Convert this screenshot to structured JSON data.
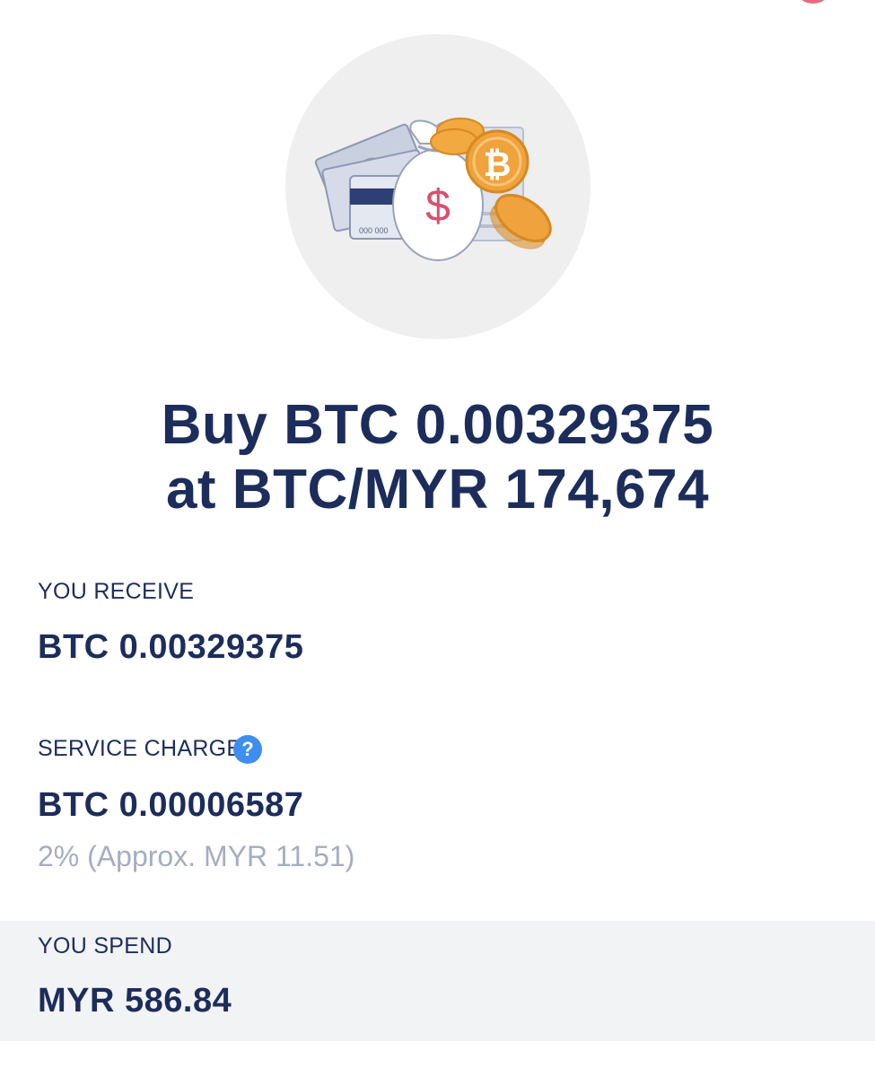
{
  "headline": {
    "line1": "Buy BTC 0.00329375",
    "line2": "at BTC/MYR 174,674"
  },
  "receive": {
    "label": "YOU RECEIVE",
    "value": "BTC 0.00329375"
  },
  "service_charge": {
    "label": "SERVICE CHARGE",
    "help_glyph": "?",
    "value": "BTC 0.00006587",
    "note": "2% (Approx. MYR 11.51)"
  },
  "spend": {
    "label": "YOU SPEND",
    "value": "MYR 586.84"
  },
  "illustration": {
    "card_number_text": "000 000",
    "bag_symbol": "$",
    "coin_symbol": "₿"
  },
  "colors": {
    "navy_text": "#1c2d5c",
    "muted_text": "#a5adc3",
    "help_blue": "#3e8ef0",
    "coin_orange": "#f0a23c",
    "dollar_pink": "#d9506e",
    "hero_bg": "#efeff0",
    "spend_bg": "#f2f3f5"
  }
}
